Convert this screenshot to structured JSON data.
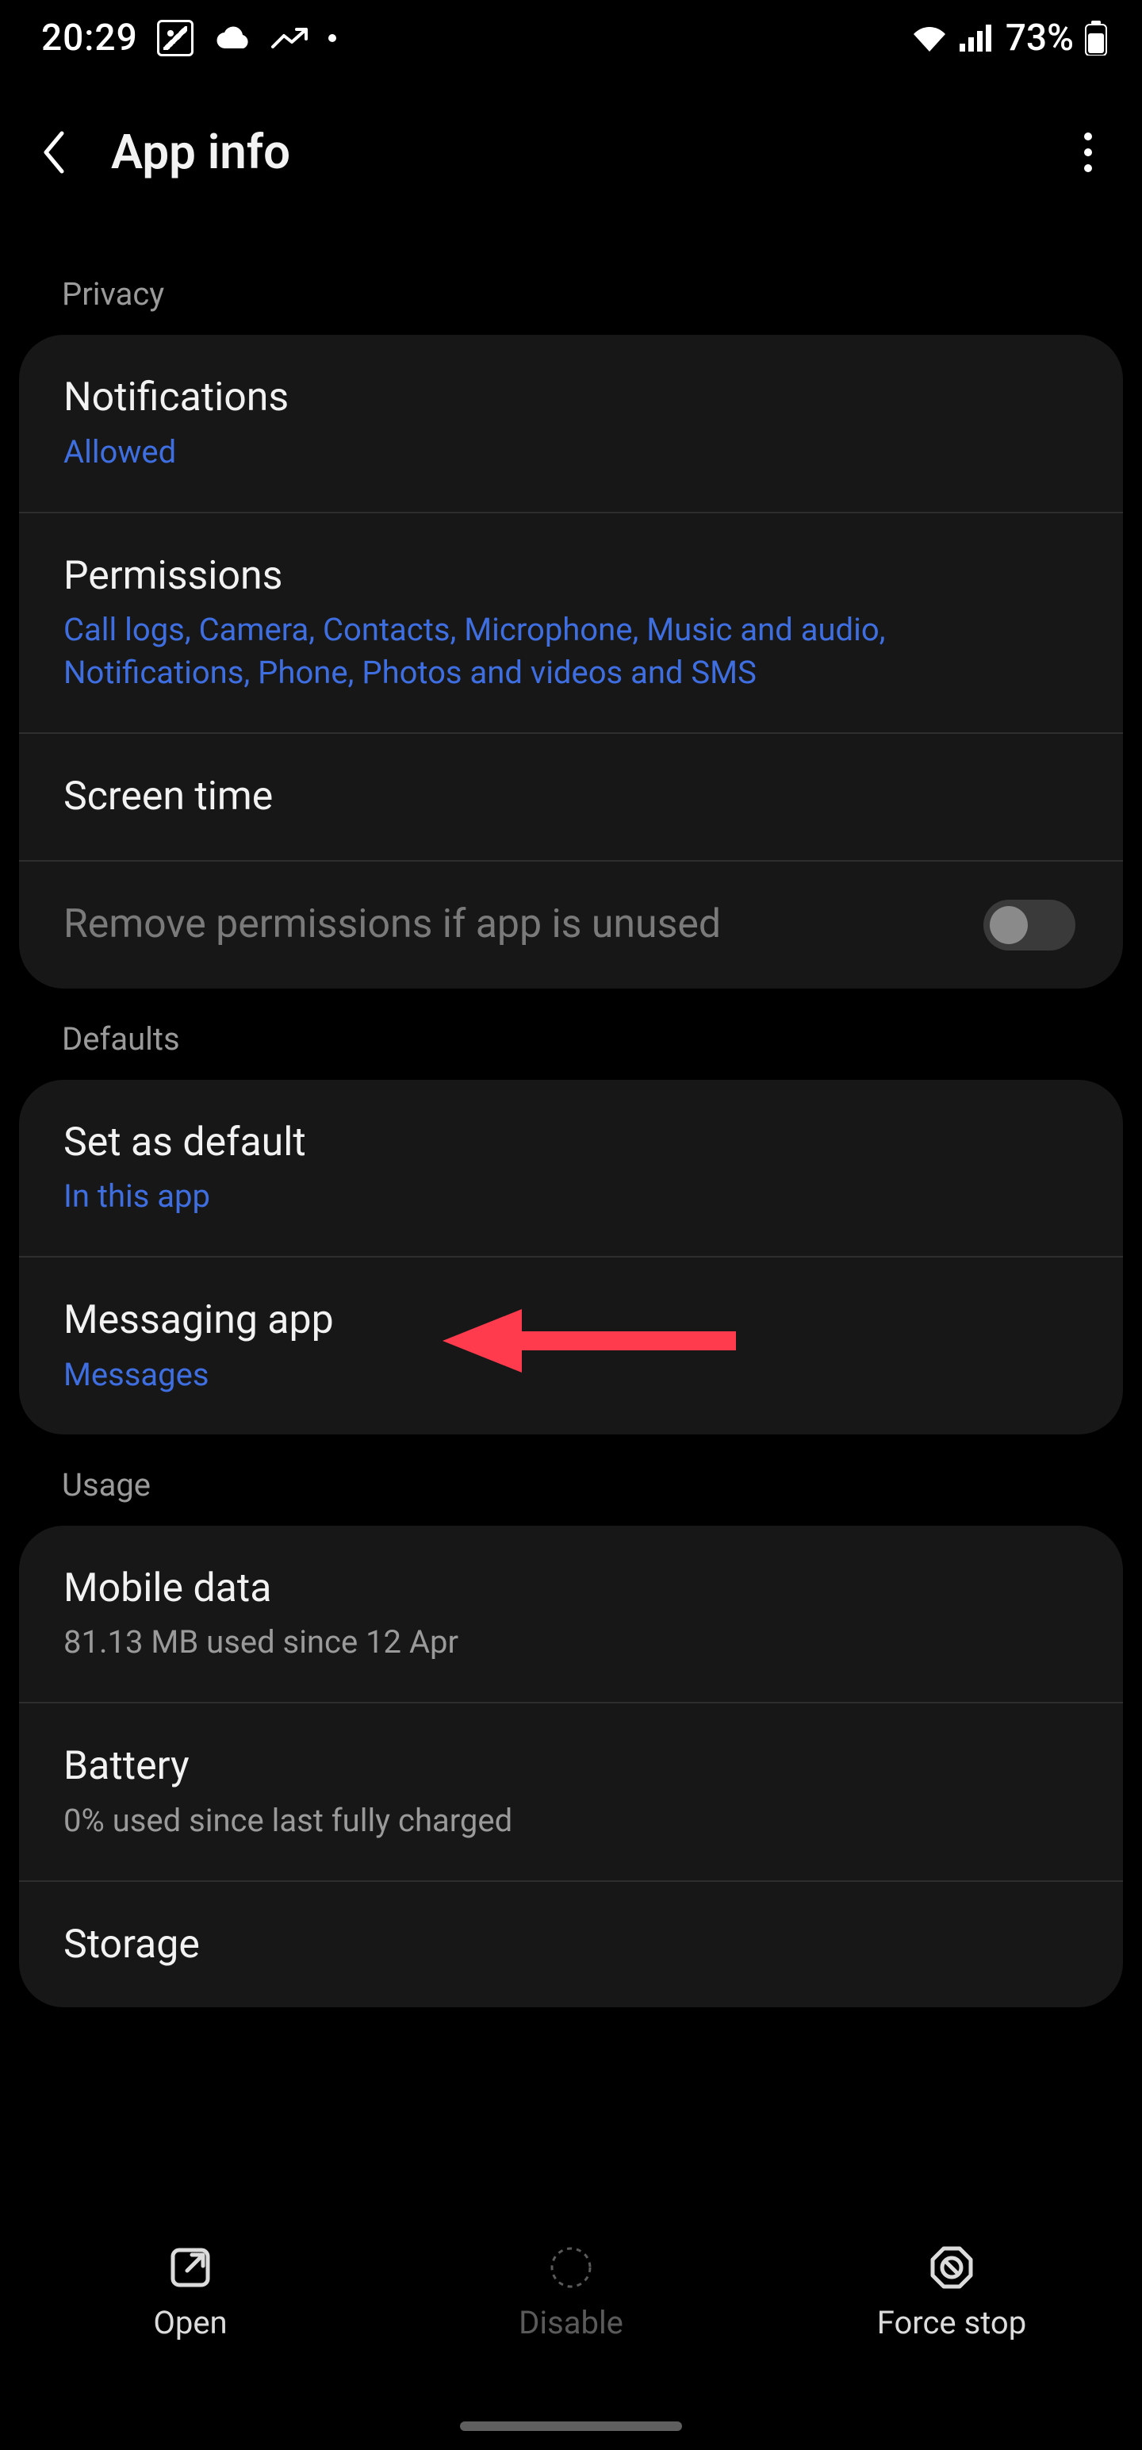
{
  "status": {
    "time": "20:29",
    "battery": "73%"
  },
  "header": {
    "title": "App info"
  },
  "sections": {
    "privacy": {
      "label": "Privacy",
      "notifications": {
        "title": "Notifications",
        "sub": "Allowed"
      },
      "permissions": {
        "title": "Permissions",
        "sub": "Call logs, Camera, Contacts, Microphone, Music and audio, Notifications, Phone, Photos and videos and SMS"
      },
      "screentime": {
        "title": "Screen time"
      },
      "removeperms": {
        "title": "Remove permissions if app is unused",
        "value": false
      }
    },
    "defaults": {
      "label": "Defaults",
      "setdefault": {
        "title": "Set as default",
        "sub": "In this app"
      },
      "messaging": {
        "title": "Messaging app",
        "sub": "Messages"
      }
    },
    "usage": {
      "label": "Usage",
      "mobiledata": {
        "title": "Mobile data",
        "sub": "81.13 MB used since 12 Apr"
      },
      "battery": {
        "title": "Battery",
        "sub": "0% used since last fully charged"
      },
      "storage": {
        "title": "Storage"
      }
    }
  },
  "bottombar": {
    "open": "Open",
    "disable": "Disable",
    "forcestop": "Force stop"
  }
}
